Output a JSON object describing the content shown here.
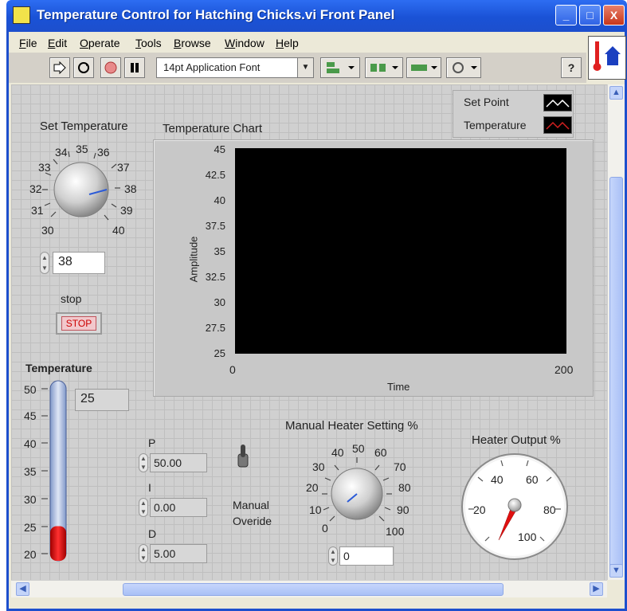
{
  "window": {
    "title": "Temperature Control for Hatching Chicks.vi Front Panel",
    "buttons": {
      "minimize": "_",
      "maximize": "□",
      "close": "X"
    }
  },
  "menu": [
    "File",
    "Edit",
    "Operate",
    "Tools",
    "Browse",
    "Window",
    "Help"
  ],
  "toolbar": {
    "font": "14pt Application Font",
    "help_icon": "?"
  },
  "set_temperature": {
    "label": "Set Temperature",
    "value": "38",
    "scale": [
      "30",
      "31",
      "32",
      "33",
      "34",
      "35",
      "36",
      "37",
      "38",
      "39",
      "40"
    ]
  },
  "stop": {
    "label": "stop",
    "button": "STOP"
  },
  "temperature": {
    "label": "Temperature",
    "value": "25",
    "scale": [
      "50",
      "45",
      "40",
      "35",
      "30",
      "25",
      "20"
    ],
    "level": 25,
    "min": 20,
    "max": 50,
    "fill_color": "#e00000"
  },
  "chart": {
    "title": "Temperature Chart",
    "ylabel": "Amplitude",
    "xlabel": "Time",
    "yticks": [
      "45",
      "42.5",
      "40",
      "37.5",
      "35",
      "32.5",
      "30",
      "27.5",
      "25"
    ],
    "xticks": [
      "0",
      "200"
    ],
    "legend": [
      {
        "name": "Set Point",
        "color": "#ffffff"
      },
      {
        "name": "Temperature",
        "color": "#d42020"
      }
    ]
  },
  "pid": {
    "p_label": "P",
    "p_value": "50.00",
    "i_label": "I",
    "i_value": "0.00",
    "d_label": "D",
    "d_value": "5.00"
  },
  "manual_override": {
    "label_line1": "Manual",
    "label_line2": "Overide"
  },
  "heater_setting": {
    "label": "Manual Heater Setting %",
    "value": "0",
    "scale": [
      "0",
      "10",
      "20",
      "30",
      "40",
      "50",
      "60",
      "70",
      "80",
      "90",
      "100"
    ]
  },
  "heater_output": {
    "label": "Heater Output %",
    "scale": [
      "20",
      "40",
      "60",
      "80",
      "100"
    ],
    "needle_color": "#e01010"
  },
  "colors": {
    "title_bar": "#1d4fcd",
    "panel_bg": "#d0d0d0",
    "plot_bg": "#000000"
  }
}
